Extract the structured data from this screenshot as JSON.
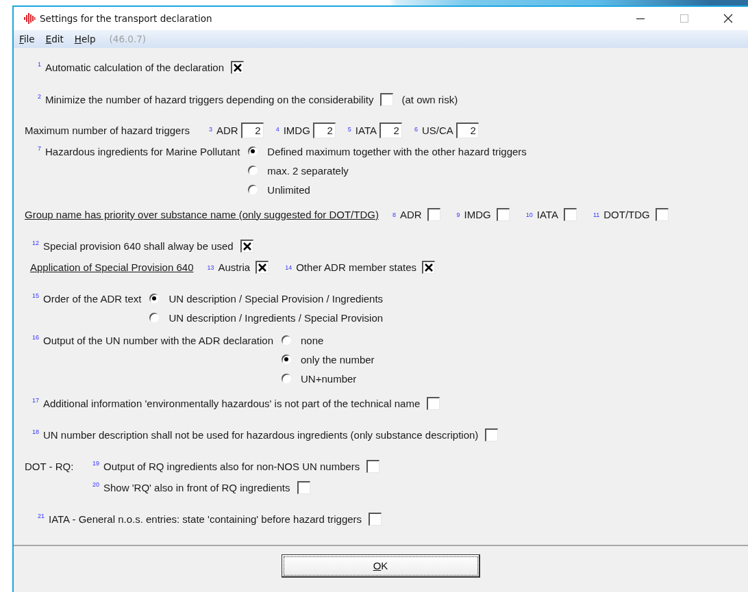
{
  "window": {
    "title": "Settings for the transport declaration"
  },
  "menu": {
    "items": [
      {
        "label": "File"
      },
      {
        "label": "Edit"
      },
      {
        "label": "Help"
      }
    ],
    "version": "(46.0.7)"
  },
  "rows": [
    {
      "kind": "checkbox",
      "number": "1",
      "label": "Automatic calculation of the declaration",
      "checked": true
    },
    {
      "kind": "checkbox",
      "number": "2",
      "label": "Minimize the number of hazard triggers depending on the considerability",
      "checked": false,
      "note": "(at own risk)"
    },
    {
      "kind": "fields",
      "label": "Maximum number of hazard triggers",
      "fields": [
        {
          "number": "3",
          "label": "ADR",
          "value": "2"
        },
        {
          "number": "4",
          "label": "IMDG",
          "value": "2"
        },
        {
          "number": "5",
          "label": "IATA",
          "value": "2"
        },
        {
          "number": "6",
          "label": "US/CA",
          "value": "2"
        }
      ]
    },
    {
      "kind": "radio",
      "number": "7",
      "label": "Hazardous ingredients for Marine Pollutant",
      "options": [
        {
          "label": "Defined maximum together with the other hazard triggers",
          "selected": true
        },
        {
          "label": "max. 2 separately",
          "selected": false
        },
        {
          "label": "Unlimited",
          "selected": false
        }
      ]
    },
    {
      "kind": "checkbox_group",
      "label": "Group name has priority over substance name (only suggested for DOT/TDG)",
      "items": [
        {
          "number": "8",
          "label": "ADR",
          "checked": false
        },
        {
          "number": "9",
          "label": "IMDG",
          "checked": false
        },
        {
          "number": "10",
          "label": "IATA",
          "checked": false
        },
        {
          "number": "11",
          "label": "DOT/TDG",
          "checked": false
        }
      ]
    },
    {
      "kind": "checkbox",
      "number": "12",
      "label": "Special provision 640 shall alway be used",
      "checked": true
    },
    {
      "kind": "checkbox_group",
      "label": "Application of Special Provision 640",
      "items": [
        {
          "number": "13",
          "label": "Austria",
          "checked": true
        },
        {
          "number": "14",
          "label": "Other ADR member states",
          "checked": true
        }
      ]
    },
    {
      "kind": "radio",
      "number": "15",
      "label": "Order of the ADR text",
      "options": [
        {
          "label": "UN description / Special Provision / Ingredients",
          "selected": true
        },
        {
          "label": "UN description / Ingredients / Special Provision",
          "selected": false
        }
      ]
    },
    {
      "kind": "radio",
      "number": "16",
      "label": "Output of the UN number with the ADR declaration",
      "options": [
        {
          "label": "none",
          "selected": false
        },
        {
          "label": "only the number",
          "selected": true
        },
        {
          "label": "UN+number",
          "selected": false
        }
      ]
    },
    {
      "kind": "checkbox",
      "number": "17",
      "label": "Additional information 'environmentally hazardous' is not part of the technical name",
      "checked": false
    },
    {
      "kind": "checkbox",
      "number": "18",
      "label": "UN number description shall not be used for hazardous ingredients (only substance description)",
      "checked": false
    },
    {
      "kind": "checkbox_set",
      "label": "DOT - RQ:",
      "items": [
        {
          "number": "19",
          "label": "Output of RQ ingredients also for non-NOS UN numbers",
          "checked": false
        },
        {
          "number": "20",
          "label": "Show 'RQ' also in front of RQ ingredients",
          "checked": false
        }
      ]
    },
    {
      "kind": "checkbox",
      "number": "21",
      "label": "IATA - General n.o.s. entries: state 'containing' before hazard triggers",
      "checked": false
    }
  ],
  "ok_button": {
    "label": "OK"
  }
}
